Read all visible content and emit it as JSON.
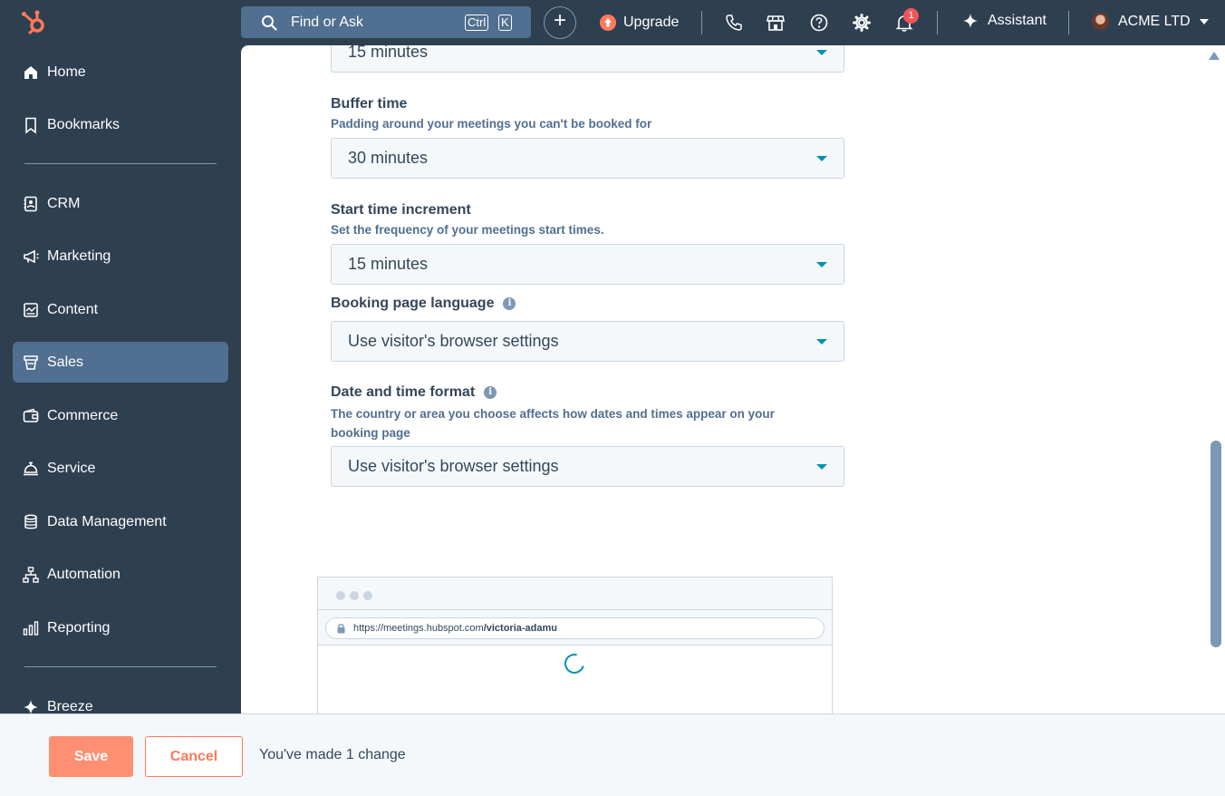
{
  "topbar": {
    "search_text": "Find or Ask",
    "kbd_ctrl": "Ctrl",
    "kbd_k": "K",
    "plus": "+",
    "upgrade_label": "Upgrade",
    "notification_count": "1",
    "assistant_label": "Assistant",
    "account_name": "ACME LTD"
  },
  "sidebar": {
    "items": [
      {
        "label": "Home",
        "icon": "home-icon"
      },
      {
        "label": "Bookmarks",
        "icon": "bookmark-icon"
      },
      {
        "label": "CRM",
        "icon": "contacts-icon"
      },
      {
        "label": "Marketing",
        "icon": "megaphone-icon"
      },
      {
        "label": "Content",
        "icon": "content-icon"
      },
      {
        "label": "Sales",
        "icon": "sales-icon",
        "active": true
      },
      {
        "label": "Commerce",
        "icon": "wallet-icon"
      },
      {
        "label": "Service",
        "icon": "service-bell-icon"
      },
      {
        "label": "Data Management",
        "icon": "database-icon"
      },
      {
        "label": "Automation",
        "icon": "workflow-icon"
      },
      {
        "label": "Reporting",
        "icon": "bar-chart-icon"
      },
      {
        "label": "Breeze",
        "icon": "sparkle-icon"
      }
    ]
  },
  "form": {
    "top_select_value": "15 minutes",
    "buffer": {
      "label": "Buffer time",
      "help": "Padding around your meetings you can't be booked for",
      "value": "30 minutes"
    },
    "increment": {
      "label": "Start time increment",
      "help": "Set the frequency of your meetings start times.",
      "value": "15 minutes"
    },
    "language": {
      "label": "Booking page language",
      "value": "Use visitor's browser settings"
    },
    "datetime": {
      "label": "Date and time format",
      "help": "The country or area you choose affects how dates and times appear on your booking page",
      "value": "Use visitor's browser settings"
    }
  },
  "preview": {
    "url_base": "https://meetings.hubspot.com",
    "url_slug": "/victoria-adamu"
  },
  "footer": {
    "save_label": "Save",
    "cancel_label": "Cancel",
    "change_text": "You've made 1 change"
  },
  "colors": {
    "nav_bg": "#2e3f50",
    "accent_orange": "#ff7a59",
    "teal": "#0091ae"
  }
}
